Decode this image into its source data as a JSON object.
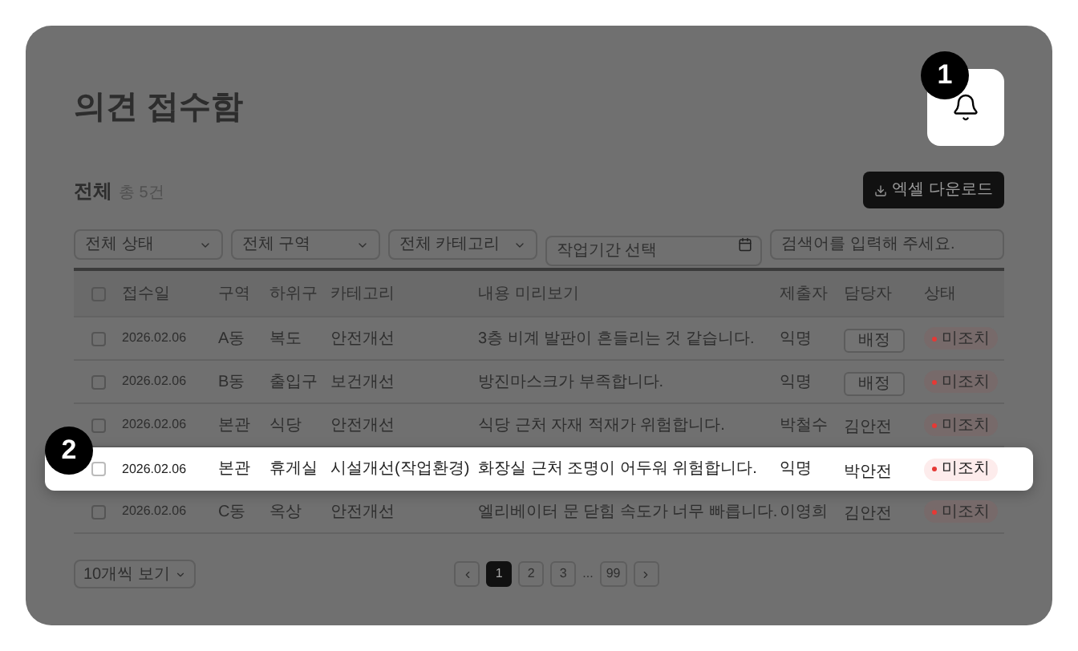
{
  "page": {
    "title": "의견 접수함"
  },
  "notification": {
    "highlighted": true,
    "step": "1"
  },
  "list": {
    "title": "전체",
    "count": "총 5건",
    "export_button": "엑셀 다운로드"
  },
  "filters": [
    {
      "kind": "select",
      "value": "전체 상태"
    },
    {
      "kind": "select",
      "value": "전체 구역"
    },
    {
      "kind": "select",
      "value": "전체 카테고리"
    },
    {
      "kind": "date",
      "placeholder": "작업기간 선택"
    },
    {
      "kind": "search",
      "placeholder": "검색어를 입력해 주세요."
    }
  ],
  "table": {
    "header_checked": false,
    "columns": [
      "접수일",
      "구역",
      "하위구",
      "카테고리",
      "내용 미리보기",
      "제출자",
      "담당자",
      "상태"
    ],
    "rows": [
      {
        "checked": false,
        "highlighted": false,
        "date": "2026.02.06",
        "zone": "A동",
        "sub_zone": "복도",
        "category": "안전개선",
        "content": "3층 비계 발판이 흔들리는 것 같습니다.",
        "submitter": "익명",
        "assignee": {
          "kind": "button",
          "label": "배정"
        },
        "status": "미조치"
      },
      {
        "checked": false,
        "highlighted": false,
        "date": "2026.02.06",
        "zone": "B동",
        "sub_zone": "출입구",
        "category": "보건개선",
        "content": "방진마스크가 부족합니다.",
        "submitter": "익명",
        "assignee": {
          "kind": "button",
          "label": "배정"
        },
        "status": "미조치"
      },
      {
        "checked": false,
        "highlighted": false,
        "date": "2026.02.06",
        "zone": "본관",
        "sub_zone": "식당",
        "category": "안전개선",
        "content": "식당 근처 자재 적재가 위험합니다.",
        "submitter": "박철수",
        "assignee": {
          "kind": "text",
          "label": "김안전"
        },
        "status": "미조치"
      },
      {
        "checked": false,
        "highlighted": true,
        "step": "2",
        "date": "2026.02.06",
        "zone": "본관",
        "sub_zone": "휴게실",
        "category": "시설개선(작업환경)",
        "content": "화장실 근처 조명이 어두워 위험합니다.",
        "submitter": "익명",
        "assignee": {
          "kind": "text",
          "label": "박안전"
        },
        "status": "미조치"
      },
      {
        "checked": false,
        "highlighted": false,
        "date": "2026.02.06",
        "zone": "C동",
        "sub_zone": "옥상",
        "category": "안전개선",
        "content": "엘리베이터 문 닫힘 속도가 너무 빠릅니다.",
        "submitter": "이영희",
        "assignee": {
          "kind": "text",
          "label": "김안전"
        },
        "status": "미조치"
      }
    ]
  },
  "footer": {
    "page_size": "10개씩 보기",
    "pages": [
      {
        "kind": "page",
        "label": "1",
        "selected": true
      },
      {
        "kind": "page",
        "label": "2",
        "selected": false
      },
      {
        "kind": "page",
        "label": "3",
        "selected": false
      },
      {
        "kind": "ellipsis",
        "label": "...",
        "selected": false
      },
      {
        "kind": "page",
        "label": "99",
        "selected": false
      }
    ]
  }
}
